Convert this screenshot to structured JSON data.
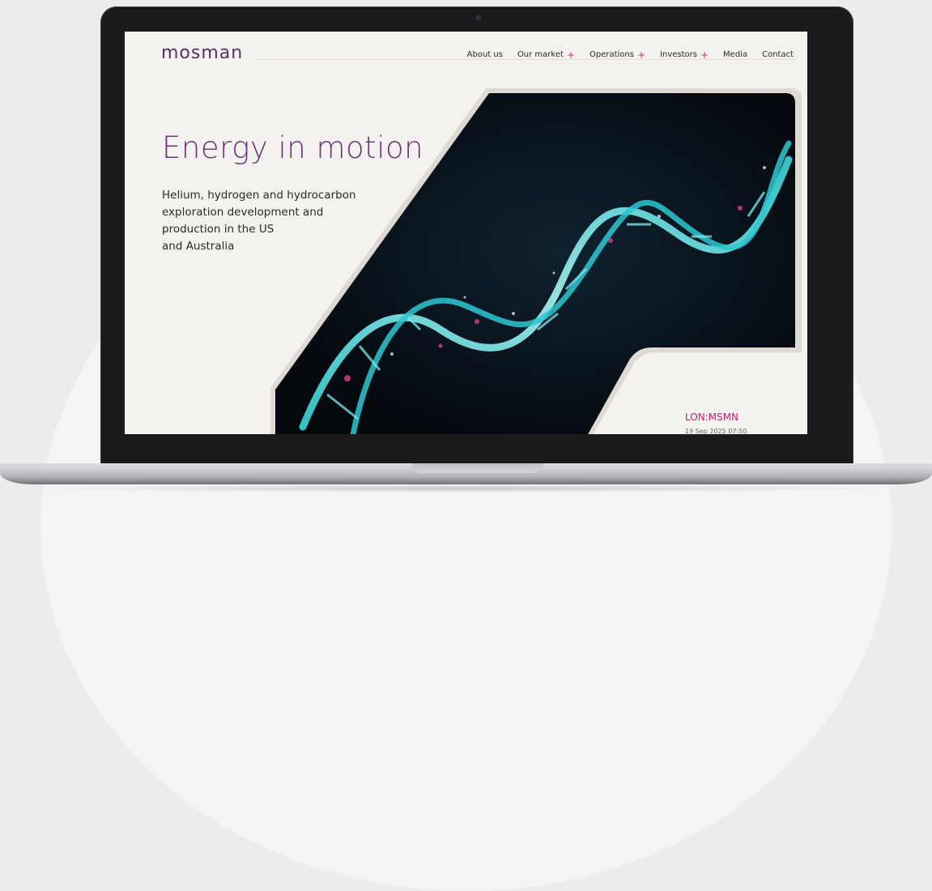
{
  "site": {
    "logo_text": "mosman",
    "brand_color": "#5a2d6e",
    "accent_color": "#d12a7c"
  },
  "nav": {
    "items": [
      {
        "label": "About us",
        "has_plus": false
      },
      {
        "label": "Our market",
        "has_plus": true
      },
      {
        "label": "Operations",
        "has_plus": true
      },
      {
        "label": "Investors",
        "has_plus": true
      },
      {
        "label": "Media",
        "has_plus": false
      },
      {
        "label": "Contact",
        "has_plus": false
      }
    ],
    "plus_symbol": "+"
  },
  "hero": {
    "title": "Energy in motion",
    "subtitle_lines": [
      "Helium, hydrogen and hydrocarbon",
      "exploration development and",
      "production in the US",
      "and Australia"
    ],
    "image_icon": "dna-helix-image"
  },
  "ticker": {
    "symbol": "LON:MSMN",
    "timestamp": "19 Sep 2025 07:50"
  }
}
